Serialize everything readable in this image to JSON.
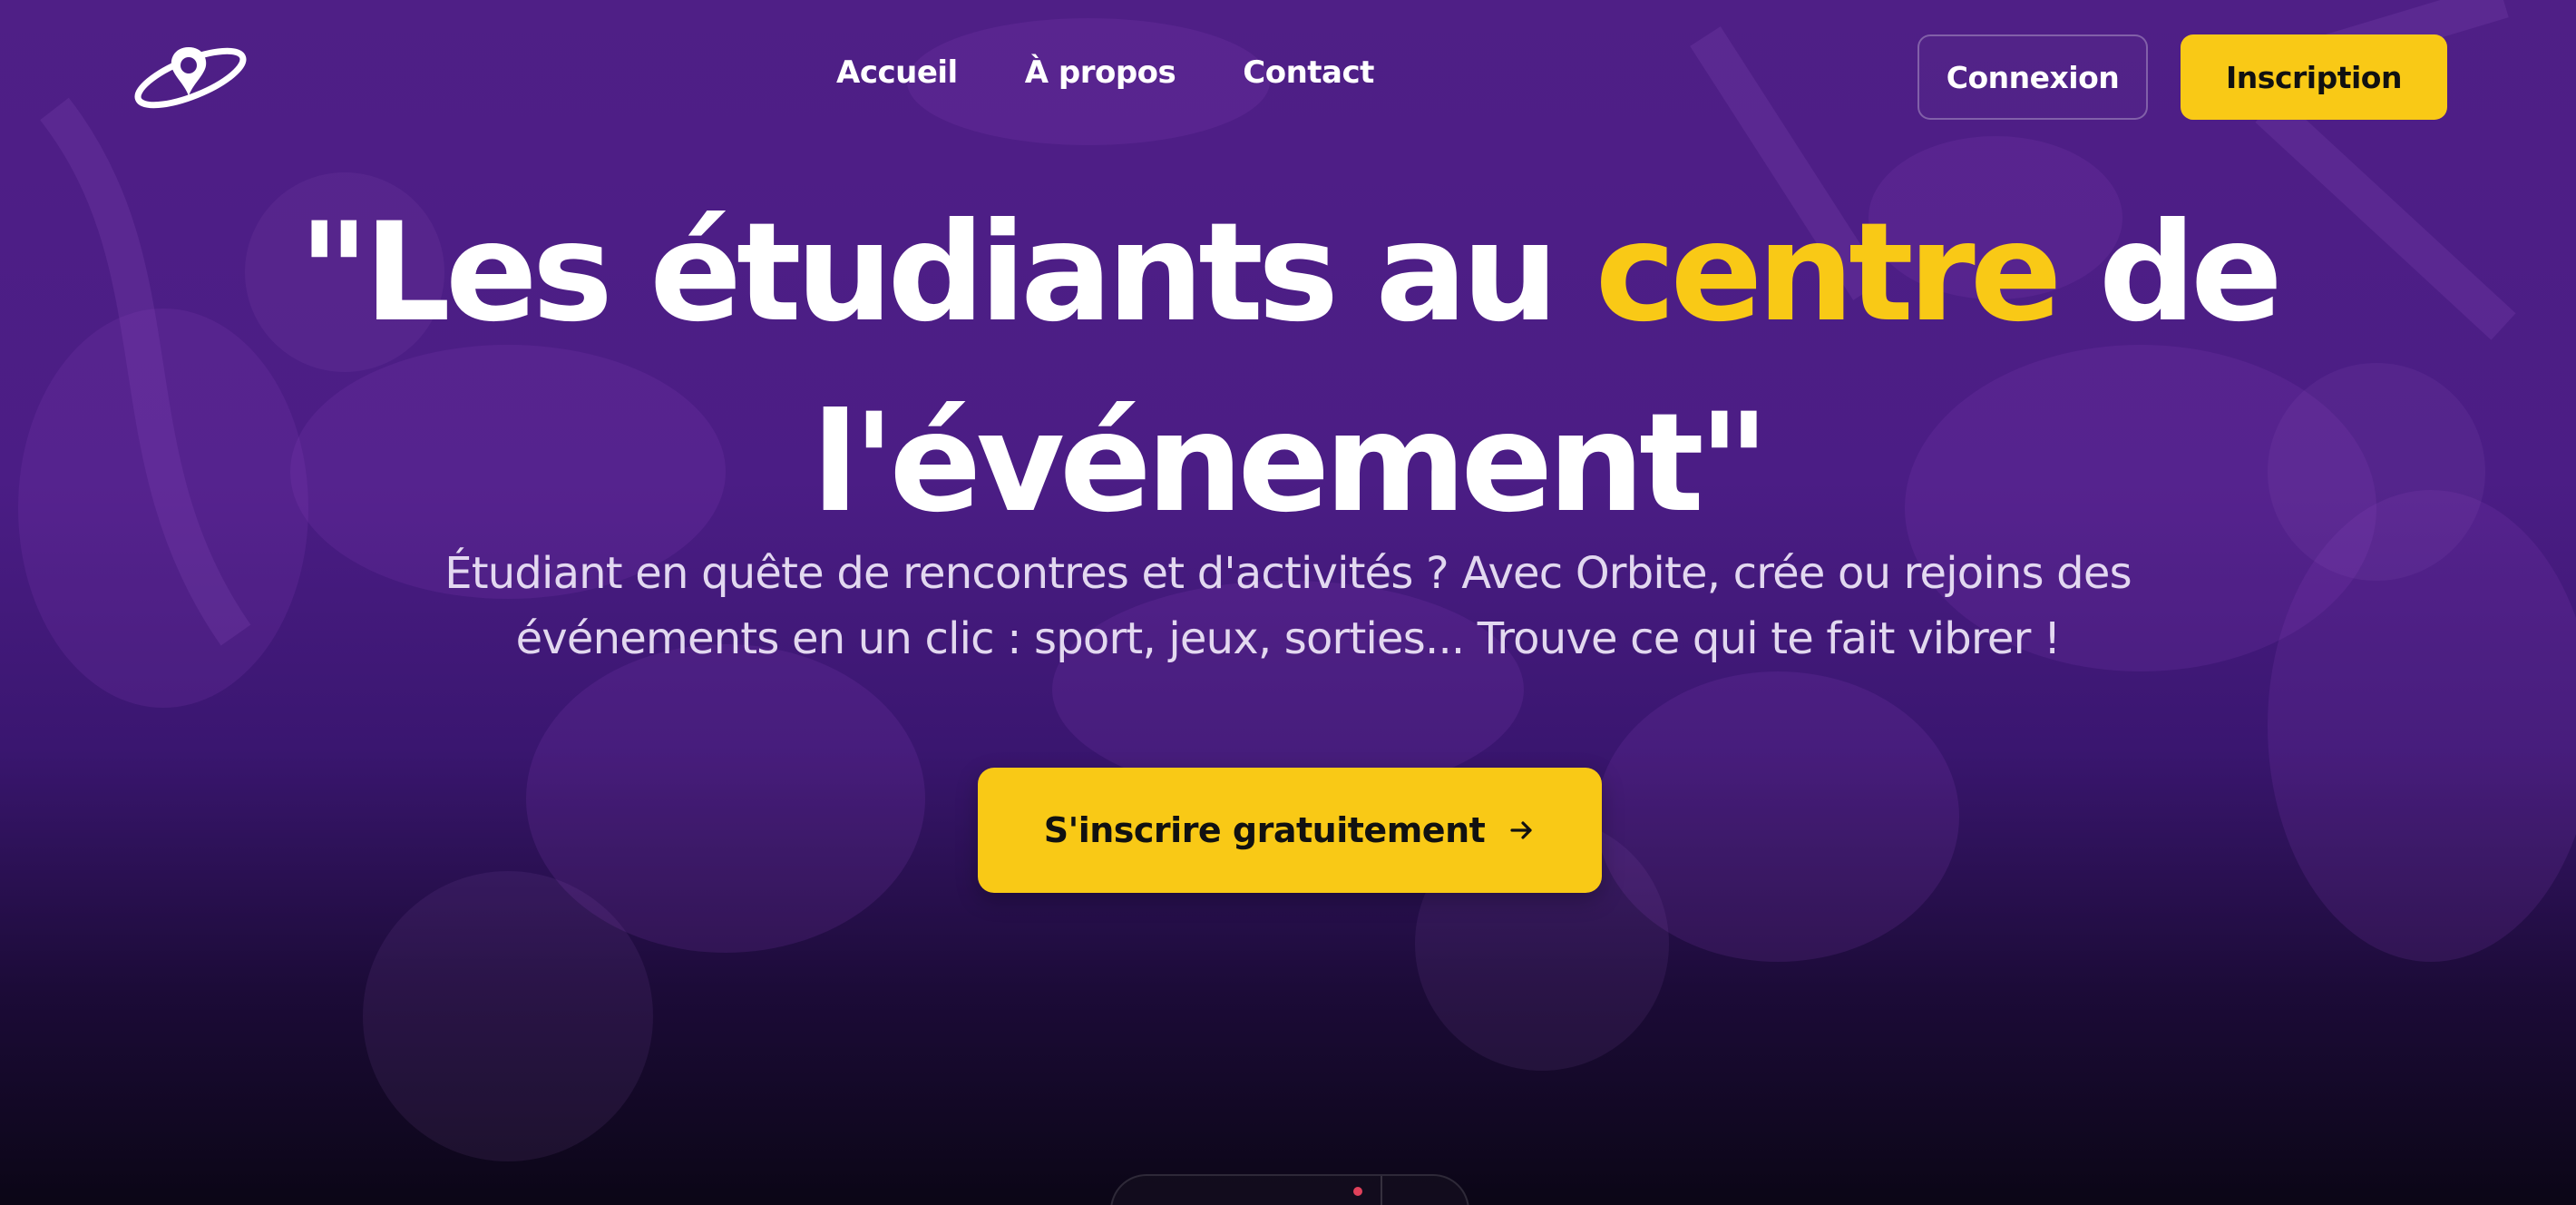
{
  "nav": {
    "links": [
      "Accueil",
      "À propos",
      "Contact"
    ],
    "login_label": "Connexion",
    "signup_label": "Inscription"
  },
  "hero": {
    "title_before": "\"Les étudiants au ",
    "title_highlight": "centre",
    "title_after": " de l'événement\"",
    "subtitle": "Étudiant en quête de rencontres et d'activités ? Avec Orbite, crée ou rejoins des événements en un clic : sport, jeux, sorties... Trouve ce qui te fait vibrer !",
    "cta_label": "S'inscrire gratuitement",
    "cta_icon": "arrow-right-icon"
  },
  "brand": {
    "logo_icon": "planet-pin-icon",
    "accent_color": "#f9c916",
    "background_color": "#4b1d85"
  }
}
